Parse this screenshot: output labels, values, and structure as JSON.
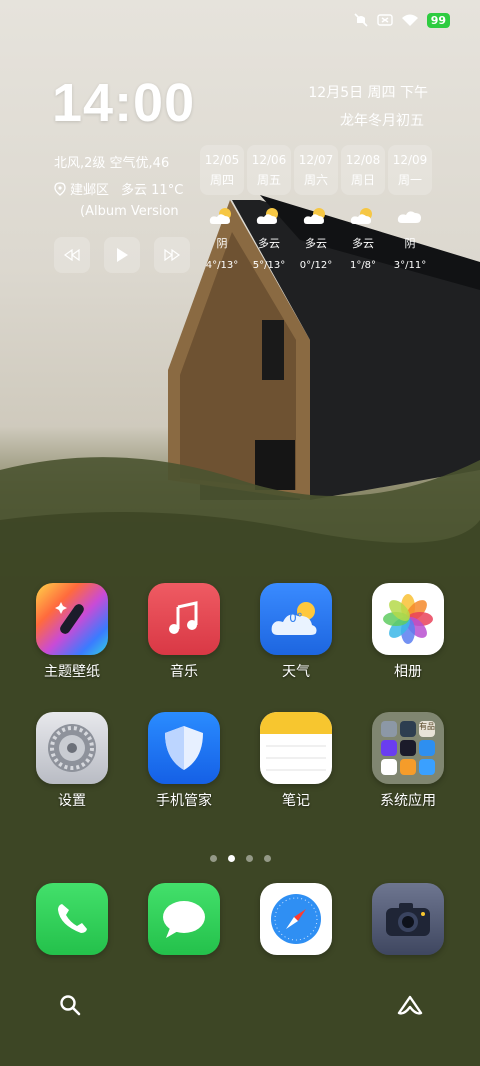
{
  "status_bar": {
    "battery": "99"
  },
  "clock": {
    "time": "14:00",
    "date": "12月5日 周四 下午",
    "lunar": "龙年冬月初五"
  },
  "weather": {
    "summary": "北风,2级 空气优,46",
    "location": "建邺区",
    "current": "多云 11°C"
  },
  "music": {
    "song_title": "(Album Version"
  },
  "forecast": [
    {
      "date": "12/05",
      "weekday": "周四",
      "icon": "partly-cloudy-icon",
      "condition": "阴",
      "temps": "4°/13°"
    },
    {
      "date": "12/06",
      "weekday": "周五",
      "icon": "partly-cloudy-icon",
      "condition": "多云",
      "temps": "5°/13°"
    },
    {
      "date": "12/07",
      "weekday": "周六",
      "icon": "partly-cloudy-icon",
      "condition": "多云",
      "temps": "0°/12°"
    },
    {
      "date": "12/08",
      "weekday": "周日",
      "icon": "partly-cloudy-icon",
      "condition": "多云",
      "temps": "1°/8°"
    },
    {
      "date": "12/09",
      "weekday": "周一",
      "icon": "cloud-icon",
      "condition": "阴",
      "temps": "3°/11°"
    }
  ],
  "apps": {
    "row1": [
      {
        "label": "主题壁纸",
        "icon": "theme-wand-icon"
      },
      {
        "label": "音乐",
        "icon": "music-note-icon"
      },
      {
        "label": "天气",
        "icon": "weather-cloud-icon",
        "badge": "0°"
      },
      {
        "label": "相册",
        "icon": "photos-flower-icon"
      }
    ],
    "row2": [
      {
        "label": "设置",
        "icon": "settings-gear-icon"
      },
      {
        "label": "手机管家",
        "icon": "shield-icon"
      },
      {
        "label": "笔记",
        "icon": "notes-icon"
      },
      {
        "label": "系统应用",
        "icon": "folder-icon",
        "folder_tag": "有品"
      }
    ]
  },
  "dock": [
    {
      "icon": "phone-icon"
    },
    {
      "icon": "message-icon"
    },
    {
      "icon": "browser-compass-icon"
    },
    {
      "icon": "camera-icon"
    }
  ],
  "pages": {
    "count": 4,
    "active": 1
  },
  "colors": {
    "battery": "#2ecc40",
    "music_red": "#e0434f",
    "weather_blue": "#2f7ff0",
    "shield_blue": "#1b7cf3",
    "phone_green": "#2fd158",
    "notes_yellow": "#f7c62f"
  }
}
